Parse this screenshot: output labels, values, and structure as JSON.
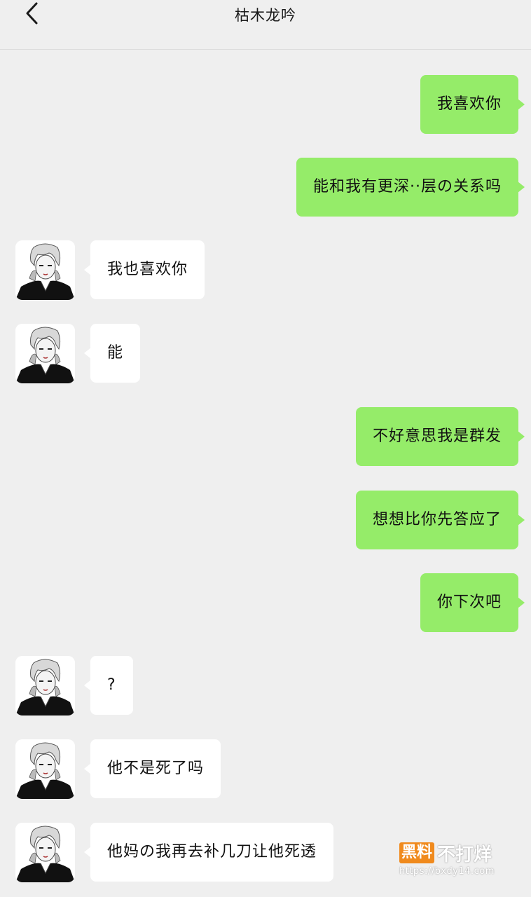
{
  "header": {
    "title": "枯木龙吟"
  },
  "messages": [
    {
      "side": "me",
      "text": "我喜欢你"
    },
    {
      "side": "me",
      "text": "能和我有更深··层の关系吗"
    },
    {
      "side": "them",
      "text": "我也喜欢你"
    },
    {
      "side": "them",
      "text": "能"
    },
    {
      "side": "me",
      "text": "不好意思我是群发"
    },
    {
      "side": "me",
      "text": "想想比你先答应了"
    },
    {
      "side": "me",
      "text": "你下次吧"
    },
    {
      "side": "them",
      "text": "?"
    },
    {
      "side": "them",
      "text": "他不是死了吗"
    },
    {
      "side": "them",
      "text": "他妈の我再去补几刀让他死透"
    }
  ],
  "watermark": {
    "brand_box": "黑料",
    "brand_text": "不打烊",
    "url": "https://bxdy14.com"
  },
  "colors": {
    "background": "#efefef",
    "my_bubble": "#95ec69",
    "their_bubble": "#ffffff"
  },
  "icons": {
    "back": "chevron-left-icon",
    "avatar": "anime-character-avatar"
  }
}
